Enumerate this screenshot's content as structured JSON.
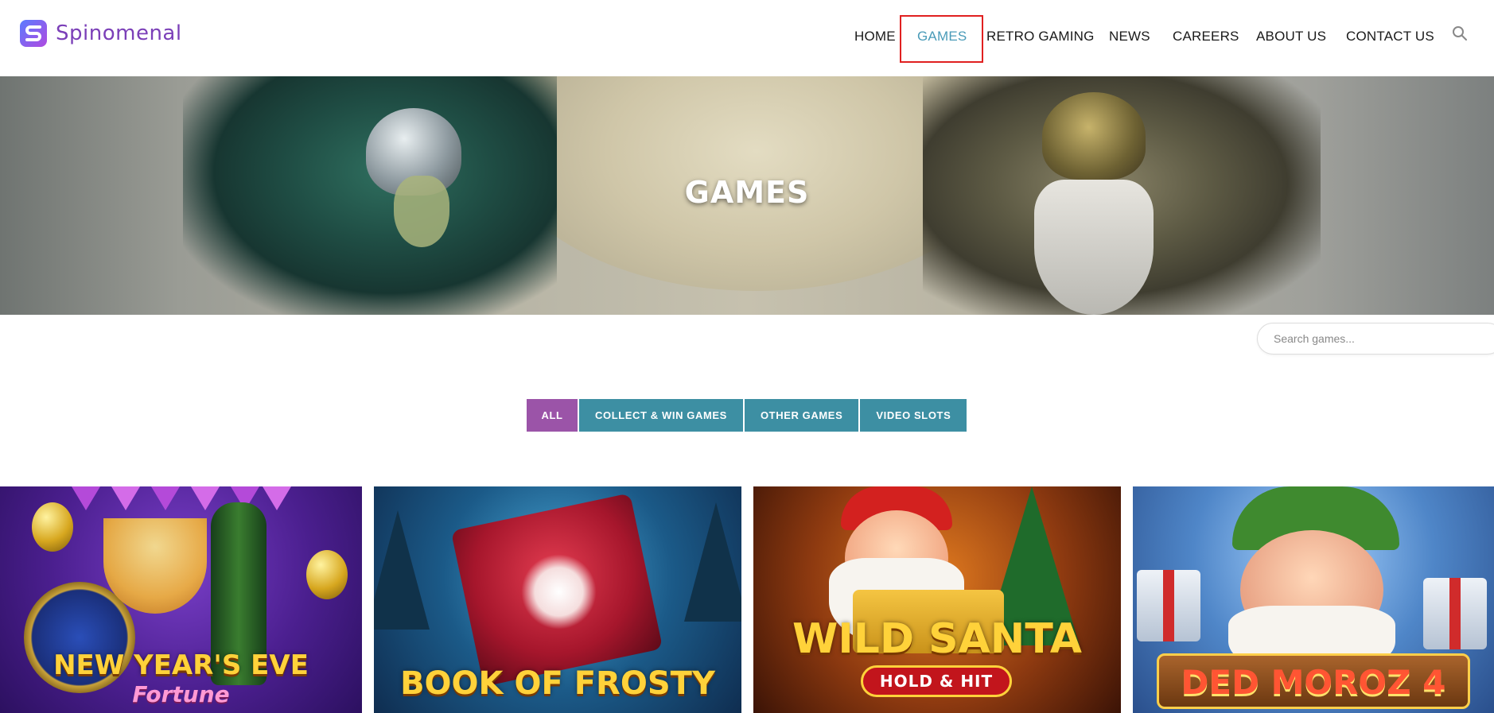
{
  "header": {
    "logo_text": "Spinomenal",
    "brand_color": "#7b3fb8",
    "nav": [
      {
        "label": "HOME",
        "active": false
      },
      {
        "label": "GAMES",
        "active": true
      },
      {
        "label": "RETRO GAMING",
        "active": false
      },
      {
        "label": "NEWS",
        "active": false
      },
      {
        "label": "CAREERS",
        "active": false
      },
      {
        "label": "ABOUT US",
        "active": false
      },
      {
        "label": "CONTACT US",
        "active": false
      }
    ],
    "search_icon": "search-icon",
    "active_color": "#4a9bb8",
    "highlight_color": "#e02020"
  },
  "hero": {
    "title": "GAMES"
  },
  "search": {
    "placeholder": "Search games..."
  },
  "filters": [
    {
      "label": "ALL",
      "active": true
    },
    {
      "label": "COLLECT & WIN GAMES",
      "active": false
    },
    {
      "label": "OTHER GAMES",
      "active": false
    },
    {
      "label": "VIDEO SLOTS",
      "active": false
    }
  ],
  "filter_colors": {
    "active": "#9b54a8",
    "inactive": "#3d8fa3"
  },
  "games": [
    {
      "title_line1": "NEW YEAR'S EVE",
      "title_line2": "Fortune"
    },
    {
      "title_line1": "BOOK OF FROSTY"
    },
    {
      "title_line1": "WILD SANTA",
      "badge": "HOLD & HIT"
    },
    {
      "title_line1": "DED MOROZ 4"
    }
  ]
}
